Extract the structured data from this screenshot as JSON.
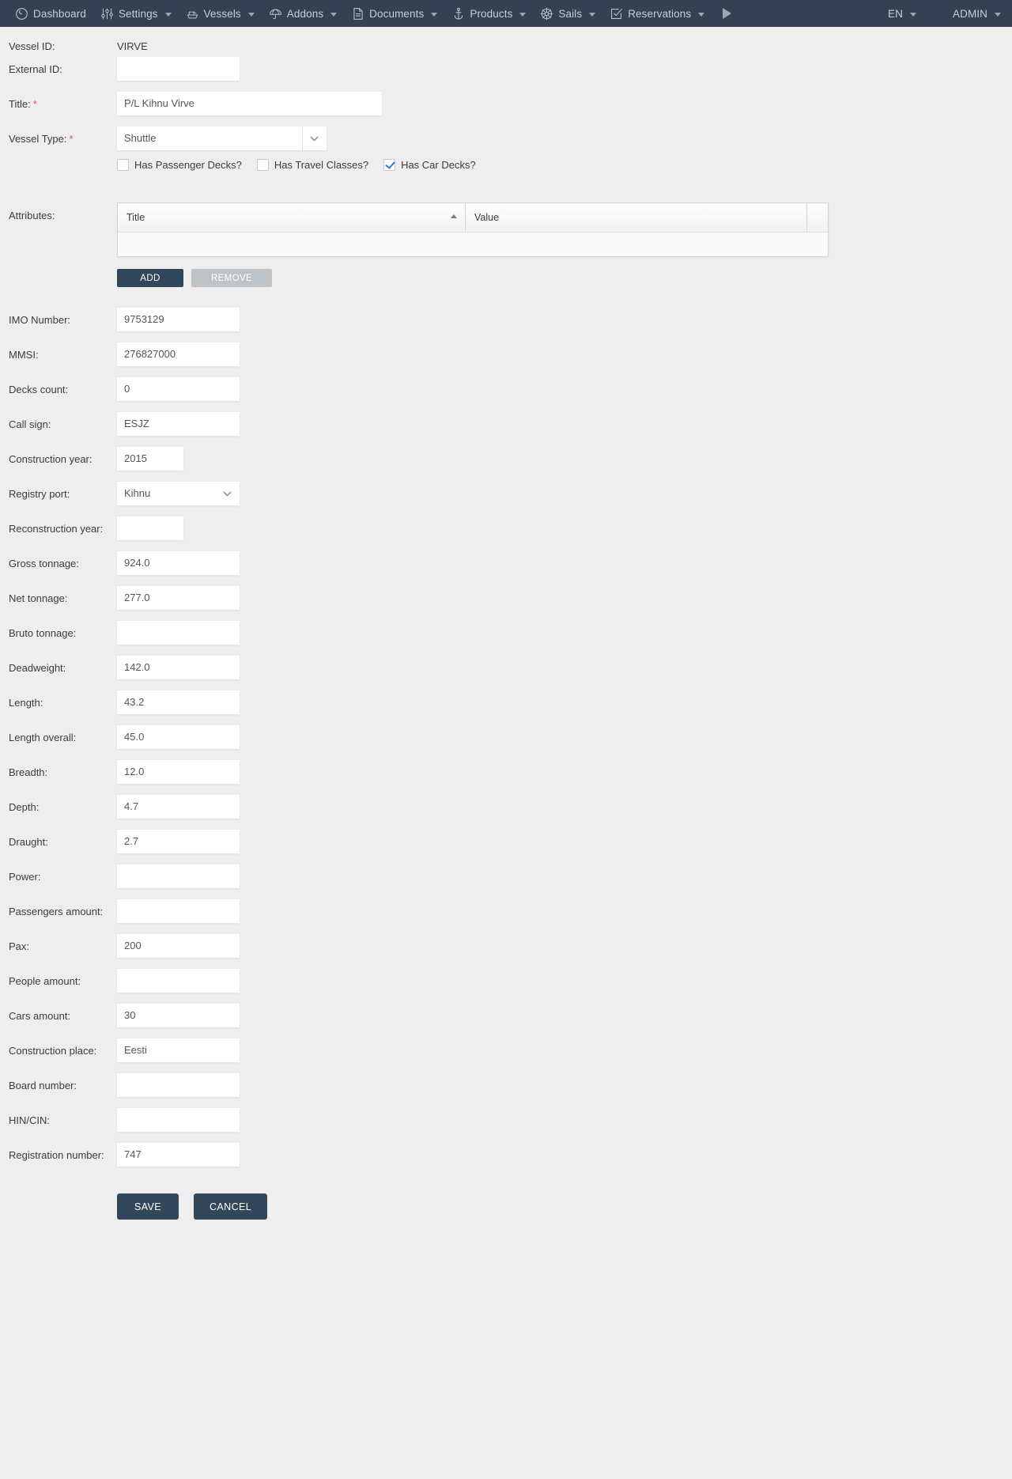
{
  "navbar": {
    "items": [
      {
        "label": "Dashboard",
        "icon": "dashboard-icon",
        "caret": false
      },
      {
        "label": "Settings",
        "icon": "sliders-icon",
        "caret": true
      },
      {
        "label": "Vessels",
        "icon": "ship-icon",
        "caret": true
      },
      {
        "label": "Addons",
        "icon": "umbrella-icon",
        "caret": true
      },
      {
        "label": "Documents",
        "icon": "document-icon",
        "caret": true
      },
      {
        "label": "Products",
        "icon": "anchor-icon",
        "caret": true
      },
      {
        "label": "Sails",
        "icon": "helm-wheel-icon",
        "caret": true
      },
      {
        "label": "Reservations",
        "icon": "checkbox-square-icon",
        "caret": true
      }
    ],
    "play_icon": "play-icon",
    "language": "EN",
    "user": "ADMIN",
    "colors": {
      "background": "#334152",
      "text": "#c6cfd8"
    }
  },
  "form": {
    "vessel_id": {
      "label": "Vessel ID:",
      "value": "VIRVE"
    },
    "external_id": {
      "label": "External ID:",
      "value": ""
    },
    "title": {
      "label": "Title:",
      "required": true,
      "value": "P/L Kihnu Virve"
    },
    "vessel_type": {
      "label": "Vessel Type:",
      "required": true,
      "value": "Shuttle"
    },
    "checkboxes": [
      {
        "label": "Has Passenger Decks?",
        "checked": false
      },
      {
        "label": "Has Travel Classes?",
        "checked": false
      },
      {
        "label": "Has Car Decks?",
        "checked": true
      }
    ],
    "attributes": {
      "label": "Attributes:",
      "columns": [
        "Title",
        "Value",
        ""
      ],
      "sorted_column": "Title",
      "sort_direction": "asc",
      "rows": [],
      "add_label": "ADD",
      "remove_label": "REMOVE"
    },
    "fields": [
      {
        "label": "IMO Number:",
        "value": "9753129",
        "type": "text",
        "width": "w155"
      },
      {
        "label": "MMSI:",
        "value": "276827000",
        "type": "text",
        "width": "w155"
      },
      {
        "label": "Decks count:",
        "value": "0",
        "type": "text",
        "width": "w155"
      },
      {
        "label": "Call sign:",
        "value": "ESJZ",
        "type": "text",
        "width": "w155"
      },
      {
        "label": "Construction year:",
        "value": "2015",
        "type": "text",
        "width": "w84"
      },
      {
        "label": "Registry port:",
        "value": "Kihnu",
        "type": "select",
        "width": "w155"
      },
      {
        "label": "Reconstruction year:",
        "value": "",
        "type": "text",
        "width": "w84"
      },
      {
        "label": "Gross tonnage:",
        "value": "924.0",
        "type": "text",
        "width": "w155"
      },
      {
        "label": "Net tonnage:",
        "value": "277.0",
        "type": "text",
        "width": "w155"
      },
      {
        "label": "Bruto tonnage:",
        "value": "",
        "type": "text",
        "width": "w155"
      },
      {
        "label": "Deadweight:",
        "value": "142.0",
        "type": "text",
        "width": "w155"
      },
      {
        "label": "Length:",
        "value": "43.2",
        "type": "text",
        "width": "w155"
      },
      {
        "label": "Length overall:",
        "value": "45.0",
        "type": "text",
        "width": "w155"
      },
      {
        "label": "Breadth:",
        "value": "12.0",
        "type": "text",
        "width": "w155"
      },
      {
        "label": "Depth:",
        "value": "4.7",
        "type": "text",
        "width": "w155"
      },
      {
        "label": "Draught:",
        "value": "2.7",
        "type": "text",
        "width": "w155"
      },
      {
        "label": "Power:",
        "value": "",
        "type": "text",
        "width": "w155"
      },
      {
        "label": "Passengers amount:",
        "value": "",
        "type": "text",
        "width": "w155"
      },
      {
        "label": "Pax:",
        "value": "200",
        "type": "text",
        "width": "w155"
      },
      {
        "label": "People amount:",
        "value": "",
        "type": "text",
        "width": "w155"
      },
      {
        "label": "Cars amount:",
        "value": "30",
        "type": "text",
        "width": "w155"
      },
      {
        "label": "Construction place:",
        "value": "Eesti",
        "type": "text",
        "width": "w155"
      },
      {
        "label": "Board number:",
        "value": "",
        "type": "text",
        "width": "w155"
      },
      {
        "label": "HIN/CIN:",
        "value": "",
        "type": "text",
        "width": "w155"
      },
      {
        "label": "Registration number:",
        "value": "747",
        "type": "text",
        "width": "w155"
      }
    ],
    "save_label": "SAVE",
    "cancel_label": "CANCEL"
  }
}
